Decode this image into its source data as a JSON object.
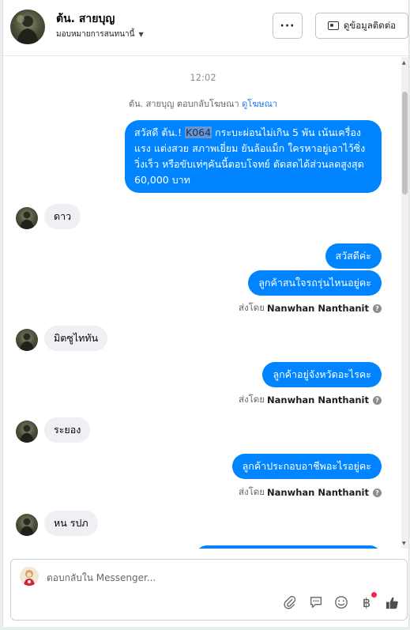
{
  "header": {
    "name": "ต้น. สายบุญ",
    "assign_label": "มอบหมายการสนทนานี้",
    "more_label": "···",
    "contact_label": "ดูข้อมูลติดต่อ"
  },
  "chat": {
    "time": "12:02",
    "ad_note": "ต้น. สายบุญ ตอบกลับโฆษณา",
    "ad_link": "ดูโฆษณา",
    "ad_message": {
      "part1": "สวัสดี ต้น.! ",
      "highlight": "K064",
      "part2": " กระบะผ่อนไม่เกิน 5 พัน เน้นเครื่องแรง แต่งสวย สภาพเยี่ยม ยันล้อแม็ก ใครหาอยู่เอาไว้ซิ่งวิ่งเร็ว หรือขับเท่ๆคันนี้ตอบโจทย์ ตัดสดได้ส่วนลดสูงสุด 60,000 บาท"
    },
    "msg_dao": "ดาว",
    "out_hello": "สวัสดีค่ะ",
    "out_model": "ลูกค้าสนใจรถรุ่นไหนอยู่คะ",
    "sent_by_prefix": "ส่งโดย",
    "agent_name": "Nanwhan Nanthanit",
    "msg_mitsu": "มิตซูไททัน",
    "out_province": "ลูกค้าอยู่จังหวัดอะไรคะ",
    "msg_rayong": "ระยอง",
    "out_job": "ลูกค้าประกอบอาชีพอะไรอยู่คะ",
    "msg_police": "หน รปภ"
  },
  "composer": {
    "placeholder": "ตอบกลับใน Messenger..."
  },
  "icons": [
    "chevron-down-icon",
    "more-icon",
    "contact-card-icon",
    "help-icon",
    "attach-icon",
    "saved-reply-icon",
    "emoji-icon",
    "baht-icon",
    "like-icon"
  ],
  "colors": {
    "accent": "#0084ff",
    "link": "#1877f2",
    "incoming": "#eef0f3"
  }
}
